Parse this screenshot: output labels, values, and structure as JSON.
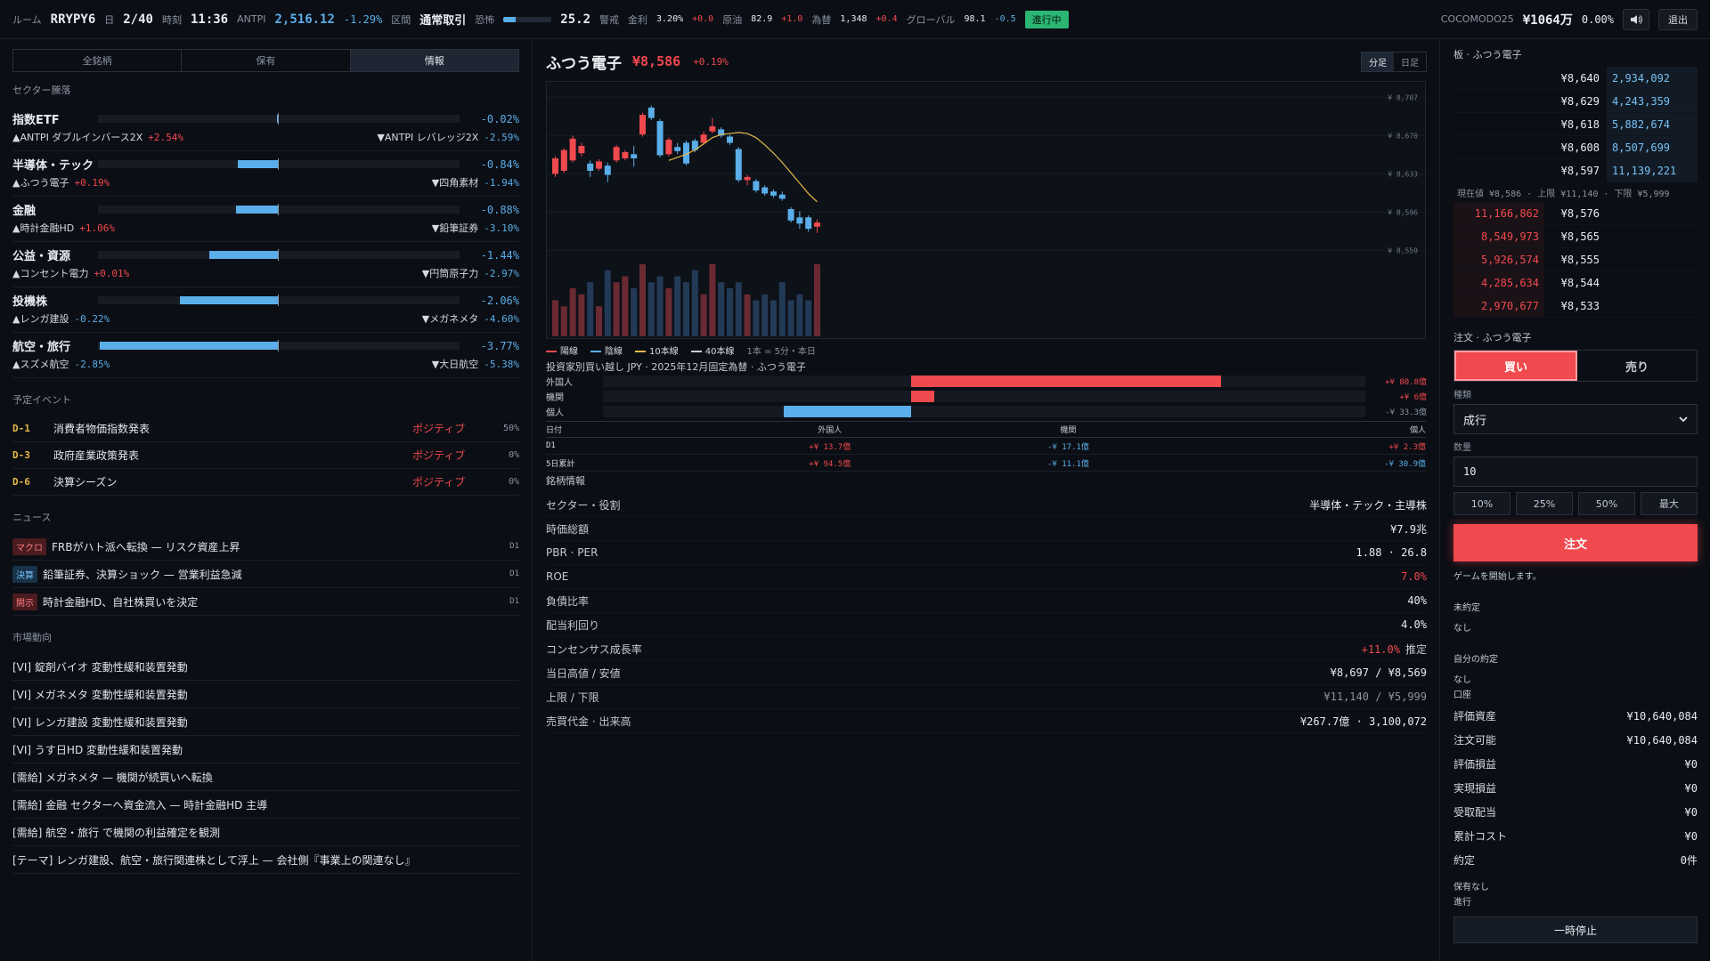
{
  "topbar": {
    "room_label": "ルーム",
    "room_code": "RRYPY6",
    "day_label": "日",
    "day_value": "2/40",
    "time_label": "時刻",
    "time_value": "11:36",
    "index_label": "ANTPI",
    "index_value": "2,516.12",
    "index_change": "-1.29%",
    "phase_label": "区間",
    "phase_value": "通常取引",
    "fear_label": "恐怖",
    "fear_value": "25.2",
    "fear_level_pct": 25,
    "fear_state": "警戒",
    "rate_label": "金利",
    "rate_value": "3.20%",
    "rate_change": "+0.0",
    "oil_label": "原油",
    "oil_value": "82.9",
    "oil_change": "+1.0",
    "fx_label": "為替",
    "fx_value": "1,348",
    "fx_change": "+0.4",
    "global_label": "グローバル",
    "global_value": "98.1",
    "global_change": "-0.5",
    "status": "進行中",
    "user": "COCOMODO25",
    "assets": "¥1064万",
    "assets_change": "0.00%",
    "sound_icon": "speaker-icon",
    "exit_label": "退出"
  },
  "left": {
    "tabs": [
      {
        "label": "全銘柄"
      },
      {
        "label": "保有"
      },
      {
        "label": "情報"
      }
    ],
    "sector_header": "セクター騰落",
    "sectors": [
      {
        "name": "指数ETF",
        "pct": "-0.02%",
        "top": "▲ANTPI ダブルインバース2X",
        "top_pct": "+2.54%",
        "bottom": "▼ANTPI レバレッジ2X",
        "bottom_pct": "-2.59%",
        "value": -0.02
      },
      {
        "name": "半導体・テック",
        "pct": "-0.84%",
        "top": "▲ふつう電子",
        "top_pct": "+0.19%",
        "bottom": "▼四角素材",
        "bottom_pct": "-1.94%",
        "value": -0.84
      },
      {
        "name": "金融",
        "pct": "-0.88%",
        "top": "▲時計金融HD",
        "top_pct": "+1.06%",
        "bottom": "▼鉛筆証券",
        "bottom_pct": "-3.10%",
        "value": -0.88
      },
      {
        "name": "公益・資源",
        "pct": "-1.44%",
        "top": "▲コンセント電力",
        "top_pct": "+0.01%",
        "bottom": "▼円筒原子力",
        "bottom_pct": "-2.97%",
        "value": -1.44
      },
      {
        "name": "投機株",
        "pct": "-2.06%",
        "top": "▲レンガ建設",
        "top_pct": "-0.22%",
        "bottom": "▼メガネメタ",
        "bottom_pct": "-4.60%",
        "value": -2.06
      },
      {
        "name": "航空・旅行",
        "pct": "-3.77%",
        "top": "▲スズメ航空",
        "top_pct": "-2.85%",
        "bottom": "▼大日航空",
        "bottom_pct": "-5.38%",
        "value": -3.77
      }
    ],
    "events_header": "予定イベント",
    "events": [
      {
        "day": "D-1",
        "name": "消費者物価指数発表",
        "tag": "ポジティブ",
        "prob": "50%"
      },
      {
        "day": "D-3",
        "name": "政府産業政策発表",
        "tag": "ポジティブ",
        "prob": "0%"
      },
      {
        "day": "D-6",
        "name": "決算シーズン",
        "tag": "ポジティブ",
        "prob": "0%"
      }
    ],
    "news_header": "ニュース",
    "news": [
      {
        "tag": "マクロ",
        "color": "red",
        "text": "FRBがハト派へ転換 — リスク資産上昇",
        "time": "D1"
      },
      {
        "tag": "決算",
        "color": "blue",
        "text": "鉛筆証券、決算ショック — 営業利益急減",
        "time": "D1"
      },
      {
        "tag": "開示",
        "color": "red",
        "text": "時計金融HD、自社株買いを決定",
        "time": "D1"
      }
    ],
    "market_header": "市場動向",
    "market": [
      {
        "text": "[VI] 錠剤バイオ 変動性緩和装置発動"
      },
      {
        "text": "[VI] メガネメタ 変動性緩和装置発動"
      },
      {
        "text": "[VI] レンガ建設 変動性緩和装置発動"
      },
      {
        "text": "[VI] うす日HD 変動性緩和装置発動"
      },
      {
        "text": "[需給] メガネメタ — 機関が続買いへ転換"
      },
      {
        "text": "[需給] 金融 セクターへ資金流入 — 時計金融HD 主導"
      },
      {
        "text": "[需給] 航空・旅行 で機関の利益確定を観測"
      },
      {
        "text": "[テーマ] レンガ建設、航空・旅行関連株として浮上 — 会社側『事業上の関連なし』"
      }
    ]
  },
  "middle": {
    "name": "ふつう電子",
    "price": "¥8,586",
    "change": "+0.19%",
    "timeframes": [
      {
        "label": "分足"
      },
      {
        "label": "日足"
      }
    ],
    "legend": {
      "up": "陽線",
      "down": "陰線",
      "ma10": "10本線",
      "ma40": "40本線",
      "note": "1本 = 5分・本日"
    },
    "flow_title": "投資家別買い越し  JPY · 2025年12月固定為替 · ふつう電子",
    "flows": [
      {
        "label": "外国人",
        "value": "+¥ 80.8億",
        "amount": 80.8
      },
      {
        "label": "機関",
        "value": "+¥ 6億",
        "amount": 6.0
      },
      {
        "label": "個人",
        "value": "-¥ 33.3億",
        "amount": -33.3
      }
    ],
    "flow_table": {
      "headers": [
        "日付",
        "外国人",
        "機関",
        "個人"
      ],
      "rows": [
        [
          "D1",
          "+¥ 13.7億",
          "-¥ 17.1億",
          "+¥ 2.3億"
        ],
        [
          "5日累計",
          "+¥ 94.5億",
          "-¥ 11.1億",
          "-¥ 30.9億"
        ]
      ]
    },
    "info_header": "銘柄情報",
    "info": [
      {
        "k": "セクター・役割",
        "v": "半導体・テック・主導株"
      },
      {
        "k": "時価総額",
        "v": "¥7.9兆"
      },
      {
        "k": "PBR · PER",
        "v": "1.88  ·  26.8"
      },
      {
        "k": "ROE",
        "v": "7.0%",
        "cls": "up"
      },
      {
        "k": "負債比率",
        "v": "40%"
      },
      {
        "k": "配当利回り",
        "v": "4.0%"
      },
      {
        "k": "コンセンサス成長率",
        "v": "+11.0%",
        "cls": "up",
        "suffix": "推定"
      },
      {
        "k": "当日高値 / 安値",
        "v": "¥8,697  /  ¥8,569"
      },
      {
        "k": "上限 / 下限",
        "v": "¥11,140  /  ¥5,999",
        "cls": "dim"
      },
      {
        "k": "売買代金 · 出来高",
        "v": "¥267.7億  ·  3,100,072"
      }
    ]
  },
  "chart_data": {
    "type": "candlestick",
    "title": "",
    "ylim": [
      8550,
      8715
    ],
    "y_ticks": [
      "¥ 8,707",
      "¥ 8,670",
      "¥ 8,633",
      "¥ 8,596",
      "¥ 8,559"
    ],
    "y_tick_values": [
      8707,
      8670,
      8633,
      8596,
      8559
    ],
    "candles": [
      {
        "o": 8633,
        "c": 8648,
        "h": 8650,
        "l": 8630
      },
      {
        "o": 8636,
        "c": 8656,
        "h": 8658,
        "l": 8634
      },
      {
        "o": 8646,
        "c": 8667,
        "h": 8670,
        "l": 8644
      },
      {
        "o": 8653,
        "c": 8660,
        "h": 8663,
        "l": 8650
      },
      {
        "o": 8643,
        "c": 8636,
        "h": 8646,
        "l": 8630
      },
      {
        "o": 8638,
        "c": 8645,
        "h": 8647,
        "l": 8636
      },
      {
        "o": 8641,
        "c": 8632,
        "h": 8644,
        "l": 8625
      },
      {
        "o": 8646,
        "c": 8659,
        "h": 8661,
        "l": 8644
      },
      {
        "o": 8648,
        "c": 8654,
        "h": 8656,
        "l": 8646
      },
      {
        "o": 8652,
        "c": 8648,
        "h": 8660,
        "l": 8640
      },
      {
        "o": 8671,
        "c": 8690,
        "h": 8692,
        "l": 8669
      },
      {
        "o": 8697,
        "c": 8687,
        "h": 8699,
        "l": 8685
      },
      {
        "o": 8684,
        "c": 8651,
        "h": 8686,
        "l": 8649
      },
      {
        "o": 8652,
        "c": 8666,
        "h": 8668,
        "l": 8650
      },
      {
        "o": 8659,
        "c": 8655,
        "h": 8663,
        "l": 8652
      },
      {
        "o": 8663,
        "c": 8643,
        "h": 8665,
        "l": 8641
      },
      {
        "o": 8665,
        "c": 8656,
        "h": 8667,
        "l": 8654
      },
      {
        "o": 8663,
        "c": 8671,
        "h": 8674,
        "l": 8661
      },
      {
        "o": 8674,
        "c": 8679,
        "h": 8687,
        "l": 8672
      },
      {
        "o": 8676,
        "c": 8670,
        "h": 8678,
        "l": 8668
      },
      {
        "o": 8669,
        "c": 8663,
        "h": 8671,
        "l": 8661
      },
      {
        "o": 8657,
        "c": 8627,
        "h": 8659,
        "l": 8625
      },
      {
        "o": 8627,
        "c": 8630,
        "h": 8632,
        "l": 8622
      },
      {
        "o": 8626,
        "c": 8617,
        "h": 8628,
        "l": 8615
      },
      {
        "o": 8620,
        "c": 8614,
        "h": 8622,
        "l": 8612
      },
      {
        "o": 8616,
        "c": 8612,
        "h": 8618,
        "l": 8610
      },
      {
        "o": 8613,
        "c": 8609,
        "h": 8616,
        "l": 8607
      },
      {
        "o": 8599,
        "c": 8588,
        "h": 8601,
        "l": 8586
      },
      {
        "o": 8591,
        "c": 8585,
        "h": 8597,
        "l": 8580
      },
      {
        "o": 8591,
        "c": 8580,
        "h": 8593,
        "l": 8577
      },
      {
        "o": 8582,
        "c": 8586,
        "h": 8589,
        "l": 8576
      }
    ],
    "ma10": [
      8646,
      8649,
      8652,
      8656,
      8662,
      8668,
      8671,
      8672,
      8673,
      8672,
      8668,
      8661,
      8653,
      8644,
      8634,
      8624,
      8614,
      8606
    ],
    "ma10_start": 13,
    "volumes": [
      6,
      5,
      8,
      7,
      9,
      5,
      11,
      9,
      10,
      8,
      12,
      9,
      10,
      8,
      10,
      9,
      11,
      7,
      12,
      9,
      8,
      9,
      7,
      6,
      7,
      6,
      9,
      6,
      7,
      6,
      12
    ]
  },
  "right": {
    "orderbook_title": "板 · ふつう電子",
    "asks": [
      {
        "price": "¥8,640",
        "qty": "2,934,092"
      },
      {
        "price": "¥8,629",
        "qty": "4,243,359"
      },
      {
        "price": "¥8,618",
        "qty": "5,882,674"
      },
      {
        "price": "¥8,608",
        "qty": "8,507,699"
      },
      {
        "price": "¥8,597",
        "qty": "11,139,221"
      }
    ],
    "mid": "現在値 ¥8,586 · 上限 ¥11,140 · 下限 ¥5,999",
    "bids": [
      {
        "price": "¥8,576",
        "qty": "11,166,862"
      },
      {
        "price": "¥8,565",
        "qty": "8,549,973"
      },
      {
        "price": "¥8,555",
        "qty": "5,926,574"
      },
      {
        "price": "¥8,544",
        "qty": "4,285,634"
      },
      {
        "price": "¥8,533",
        "qty": "2,970,677"
      }
    ],
    "order_title": "注文 · ふつう電子",
    "buy_label": "買い",
    "sell_label": "売り",
    "type_label": "種類",
    "type_value": "成行",
    "qty_label": "数量",
    "qty_value": "10",
    "pct_buttons": [
      {
        "label": "10%"
      },
      {
        "label": "25%"
      },
      {
        "label": "50%"
      },
      {
        "label": "最大"
      }
    ],
    "order_label": "注文",
    "note": "ゲームを開始します。",
    "pending_label": "未約定",
    "pending_value": "なし",
    "fills_label": "自分の約定",
    "fills_value": "なし",
    "account_label": "口座",
    "account": [
      {
        "k": "評価資産",
        "v": "¥10,640,084"
      },
      {
        "k": "注文可能",
        "v": "¥10,640,084"
      },
      {
        "k": "評価損益",
        "v": "¥0"
      },
      {
        "k": "実現損益",
        "v": "¥0"
      },
      {
        "k": "受取配当",
        "v": "¥0"
      },
      {
        "k": "累計コスト",
        "v": "¥0"
      },
      {
        "k": "約定",
        "v": "0件"
      }
    ],
    "holding_label": "保有なし",
    "progress_label": "進行",
    "pause_label": "一時停止"
  }
}
